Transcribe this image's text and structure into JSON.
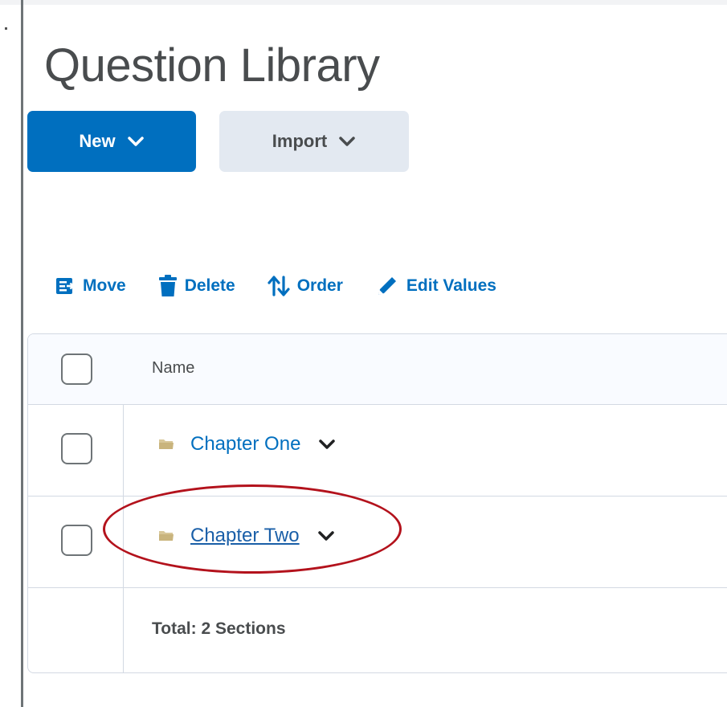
{
  "page": {
    "title": "Question Library"
  },
  "buttons": {
    "new_label": "New",
    "import_label": "Import"
  },
  "toolbar": {
    "move_label": "Move",
    "delete_label": "Delete",
    "order_label": "Order",
    "edit_values_label": "Edit Values"
  },
  "table": {
    "header": {
      "name": "Name"
    },
    "rows": [
      {
        "name": "Chapter One",
        "icon": "folder-icon"
      },
      {
        "name": "Chapter Two",
        "icon": "folder-icon"
      }
    ],
    "footer": {
      "total_label": "Total:",
      "total_value": "2 Sections"
    }
  },
  "colors": {
    "accent": "#006fbf",
    "secondary_button": "#e3e9f1",
    "highlight_ring": "#b3121c"
  }
}
